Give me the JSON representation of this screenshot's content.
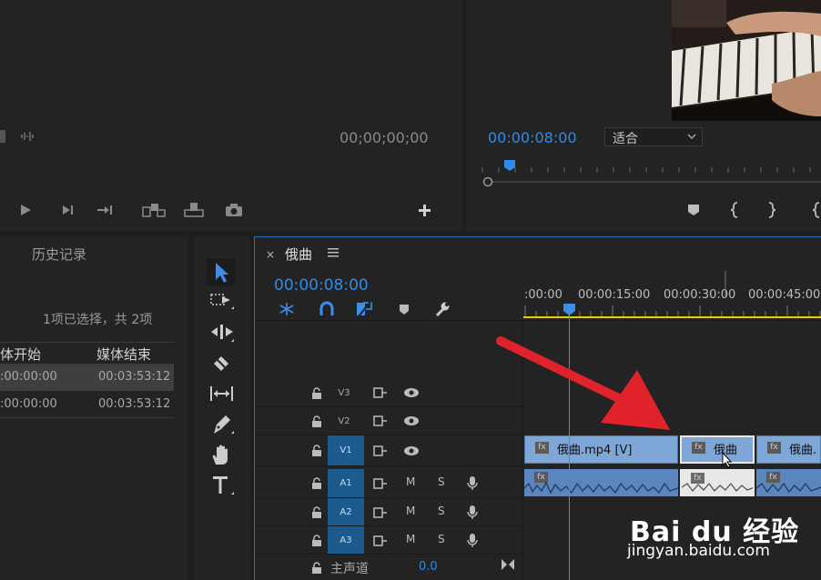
{
  "source_monitor": {
    "timecode": "00;00;00;00"
  },
  "program_monitor": {
    "timecode": "00:00:08:00",
    "fit_label": "适合"
  },
  "history": {
    "tab_label": "历史记录",
    "selection_status": "1项已选择，共 2项"
  },
  "project_table": {
    "columns": [
      "体开始",
      "媒体结束"
    ],
    "rows": [
      {
        "start": ":00:00:00",
        "end": "00:03:53:12"
      },
      {
        "start": ":00:00:00",
        "end": "00:03:53:12"
      }
    ]
  },
  "timeline": {
    "sequence_name": "俄曲",
    "timecode": "00:00:08:00",
    "ruler": [
      ":00:00",
      "00:00:15:00",
      "00:00:30:00",
      "00:00:45:00"
    ],
    "tracks": {
      "v3": "V3",
      "v2": "V2",
      "v1": "V1",
      "a1": "A1",
      "a2": "A2",
      "a3": "A3",
      "m": "M",
      "s": "S",
      "master": "主声道",
      "master_value": "0.0"
    },
    "clips": {
      "v1_a": "俄曲.mp4 [V]",
      "v1_b": "俄曲",
      "v1_c": "俄曲."
    }
  },
  "watermark": {
    "brand": "Bai du 经验",
    "url": "jingyan.baidu.com"
  },
  "colors": {
    "accent": "#2d8ceb",
    "clip_video": "#7ea7d8",
    "clip_audio": "#5b86bd",
    "arrow": "#e0232b"
  }
}
